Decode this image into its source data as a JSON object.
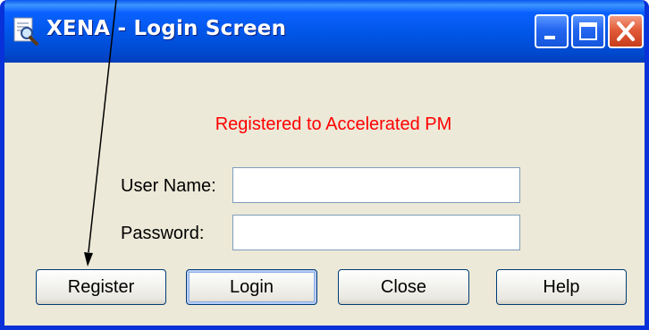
{
  "window": {
    "title": "XENA - Login Screen",
    "controls": [
      "minimize-icon",
      "maximize-icon",
      "close-icon"
    ]
  },
  "main": {
    "registered_text": "Registered to Accelerated PM",
    "registered_color": "#FF0000",
    "user_name_label": "User Name:",
    "user_name_value": "",
    "password_label": "Password:",
    "password_value": ""
  },
  "buttons": {
    "register": "Register",
    "login": "Login",
    "close": "Close",
    "help": "Help"
  },
  "colors": {
    "titlebar": "#0055E5",
    "window_bg": "#ECE9D8",
    "close_button": "#E25C3A"
  }
}
